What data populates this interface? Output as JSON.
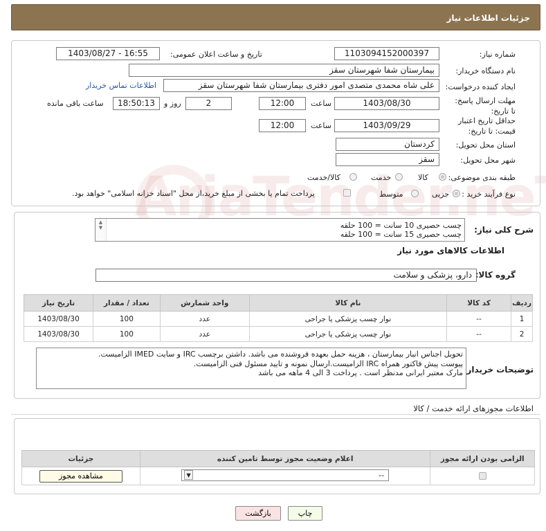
{
  "header": {
    "title": "جزئیات اطلاعات نیاز"
  },
  "form": {
    "need_number_label": "شماره نیاز:",
    "need_number": "1103094152000397",
    "announce_label": "تاریخ و ساعت اعلان عمومی:",
    "announce_value": "1403/08/27 - 16:55",
    "buyer_org_label": "نام دستگاه خریدار:",
    "buyer_org": "بیمارستان شفا شهرستان سقز",
    "creator_label": "ایجاد کننده درخواست:",
    "creator": "علی شاه محمدی متصدی امور دفتری بیمارستان شفا شهرستان سقز",
    "buyer_contact_link": "اطلاعات تماس خریدار",
    "deadline_label": "مهلت ارسال پاسخ: تا تاریخ:",
    "deadline_date": "1403/08/30",
    "time_label": "ساعت",
    "deadline_time": "12:00",
    "days_value": "2",
    "days_label": "روز و",
    "remaining_time": "18:50:13",
    "remaining_label": "ساعت باقی مانده",
    "validity_label": "حداقل تاریخ اعتبار قیمت: تا تاریخ:",
    "validity_date": "1403/09/29",
    "validity_time": "12:00",
    "province_label": "استان محل تحویل:",
    "province": "کردستان",
    "city_label": "شهر محل تحویل:",
    "city": "سقز",
    "category_label": "طبقه بندی موضوعی:",
    "category_options": [
      "کالا",
      "خدمت",
      "کالا/خدمت"
    ],
    "purchase_type_label": "نوع فرآیند خرید :",
    "purchase_options": [
      "جزیی",
      "متوسط"
    ],
    "payment_note": "پرداخت تمام یا بخشی از مبلغ خرید،از محل \"اسناد خزانه اسلامی\" خواهد بود."
  },
  "description": {
    "label": "شرح کلی نیاز:",
    "lines": [
      "چسب حصیری 10 سانت = 100 حلقه",
      "چسب حصیری 15 سانت = 100 حلقه"
    ]
  },
  "goods_info": {
    "title": "اطلاعات کالاهای مورد نیاز",
    "group_label": "گروه کالا:",
    "group_value": "دارو، پزشکی و سلامت"
  },
  "goods_table": {
    "headers": [
      "ردیف",
      "کد کالا",
      "نام کالا",
      "واحد شمارش",
      "تعداد / مقدار",
      "تاریخ نیاز"
    ],
    "rows": [
      [
        "1",
        "--",
        "نوار چسب پزشکی یا جراحی",
        "عدد",
        "100",
        "1403/08/30"
      ],
      [
        "2",
        "--",
        "نوار چسب پزشکی یا جراحی",
        "عدد",
        "100",
        "1403/08/30"
      ]
    ]
  },
  "buyer_notes": {
    "label": "توضیحات خریدار:",
    "lines": [
      "تحویل اجناس انبار بیمارستان ، هزینه حمل بعهده فروشنده می باشد. داشتن برچسب IRC و سایت IMED الزامیست.",
      "پیوست پیش فاکتور همراه IRC الزامیست.ارسال نمونه و تایید مسئول فنی الزامیست.",
      "مارک معتبر ایرانی مدنظر است . پرداخت 3 الی 4 ماهه می باشد"
    ]
  },
  "permits": {
    "section_title": "اطلاعات مجوزهای ارائه خدمت / کالا",
    "headers": [
      "الزامی بودن ارائه مجوز",
      "اعلام وضعیت مجوز توسط تامین کننده",
      "جزئیات"
    ],
    "select_value": "--",
    "view_button": "مشاهده مجوز"
  },
  "actions": {
    "print": "چاپ",
    "back": "بازگشت"
  },
  "watermark": {
    "text": "AriaTender.neT"
  },
  "colors": {
    "header_bg": "#8c7451",
    "link": "#2255aa",
    "back_btn_bg": "#fbe3e3"
  }
}
